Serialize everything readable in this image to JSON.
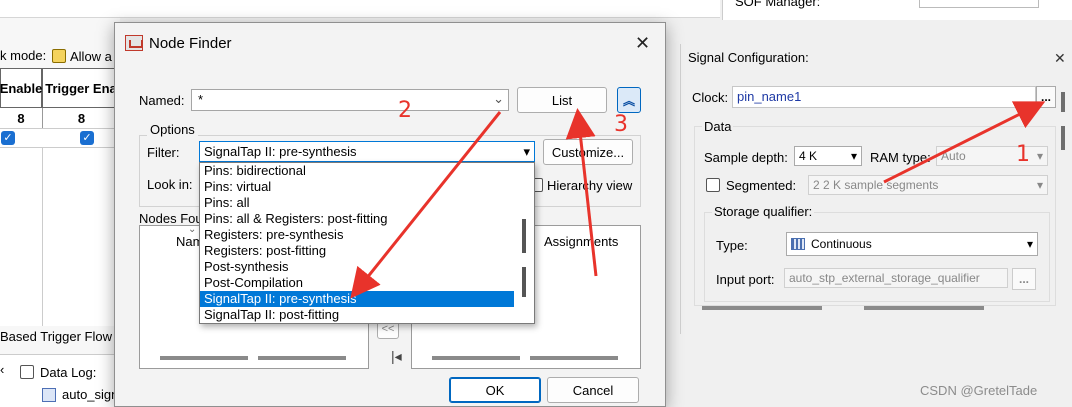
{
  "background": {
    "lock_mode_label": "k mode:",
    "allow_label": "Allow a",
    "col_enable": "Enable",
    "col_trigger_enable": "Trigger Ena",
    "row_value_1": "8",
    "row_value_2": "8",
    "based_trigger_flow": "Based Trigger Flow",
    "data_log_label": "Data Log:",
    "auto_signal": "auto_sign",
    "sof_manager": "SOF Manager:"
  },
  "signal_config": {
    "title": "Signal Configuration:",
    "clock_label": "Clock:",
    "clock_value": "pin_name1",
    "browse_label": "...",
    "data_group": "Data",
    "sample_depth_label": "Sample depth:",
    "sample_depth_value": "4 K",
    "ram_type_label": "RAM type:",
    "ram_type_value": "Auto",
    "segmented_label": "Segmented:",
    "segmented_value": "2  2 K sample segments",
    "storage_qualifier_label": "Storage qualifier:",
    "type_label": "Type:",
    "type_value": "Continuous",
    "input_port_label": "Input port:",
    "input_port_value": "auto_stp_external_storage_qualifier",
    "input_port_btn": "..."
  },
  "dialog": {
    "title": "Node Finder",
    "named_label": "Named:",
    "named_value": "*",
    "list_button": "List",
    "options_label": "Options",
    "filter_label": "Filter:",
    "filter_value": "SignalTap II: pre-synthesis",
    "customize_button": "Customize...",
    "look_in_label": "Look in:",
    "hierarchy_view_label": "Hierarchy view",
    "nodes_found_label": "Nodes Fou",
    "name_col": "Nam",
    "assignments_col": "Assignments",
    "move_left": "<<",
    "ok_button": "OK",
    "cancel_button": "Cancel",
    "filter_options": [
      "Pins: bidirectional",
      "Pins: virtual",
      "Pins: all",
      "Pins: all & Registers: post-fitting",
      "Registers: pre-synthesis",
      "Registers: post-fitting",
      "Post-synthesis",
      "Post-Compilation",
      "SignalTap II: pre-synthesis",
      "SignalTap II: post-fitting"
    ],
    "selected_index": 8
  },
  "annotations": {
    "n1": "1",
    "n2": "2",
    "n3": "3",
    "arrow_color": "#e8332b"
  },
  "watermark": "CSDN @GretelTade"
}
